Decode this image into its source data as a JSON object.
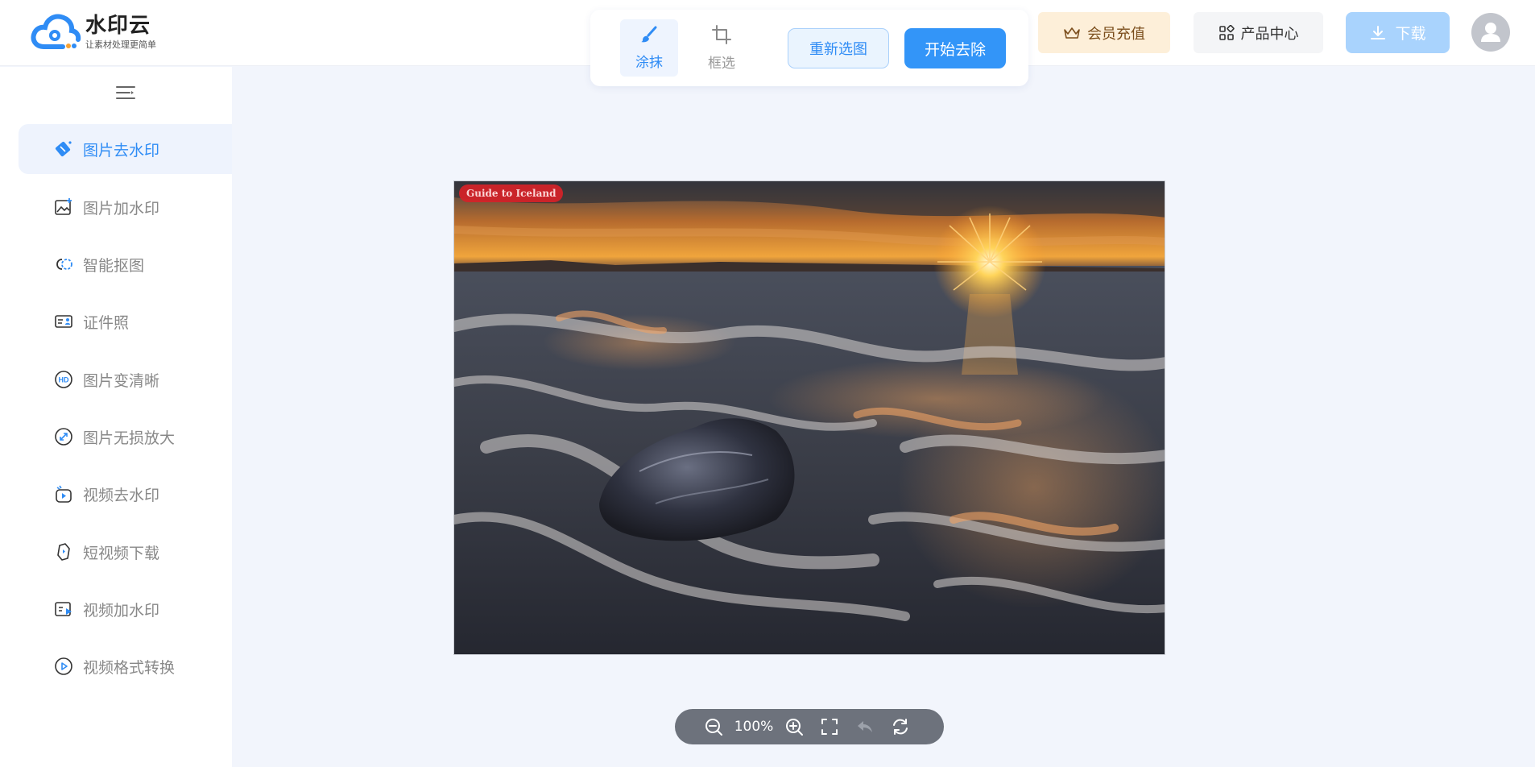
{
  "header": {
    "logo_name": "水印云",
    "logo_slogan": "让素材处理更简单",
    "member_label": "会员充值",
    "products_label": "产品中心",
    "download_label": "下载"
  },
  "toolbar": {
    "smear_label": "涂抹",
    "box_label": "框选",
    "reselect_label": "重新选图",
    "start_label": "开始去除"
  },
  "sidebar": {
    "items": [
      {
        "label": "图片去水印",
        "icon": "eraser-icon",
        "active": true
      },
      {
        "label": "图片加水印",
        "icon": "image-add-icon"
      },
      {
        "label": "智能抠图",
        "icon": "cutout-icon"
      },
      {
        "label": "证件照",
        "icon": "id-card-icon"
      },
      {
        "label": "图片变清晰",
        "icon": "hd-icon"
      },
      {
        "label": "图片无损放大",
        "icon": "enlarge-icon"
      },
      {
        "label": "视频去水印",
        "icon": "video-erase-icon"
      },
      {
        "label": "短视频下载",
        "icon": "video-download-icon"
      },
      {
        "label": "视频加水印",
        "icon": "video-add-icon"
      },
      {
        "label": "视频格式转换",
        "icon": "video-convert-icon"
      }
    ]
  },
  "canvas": {
    "watermark_text": "Guide to Iceland"
  },
  "zoom": {
    "value": "100%"
  },
  "colors": {
    "accent": "#3395f8",
    "member_bg": "#fdefd9",
    "download_bg": "#a9d3fd",
    "canvas_bg": "#f2f5fc"
  }
}
